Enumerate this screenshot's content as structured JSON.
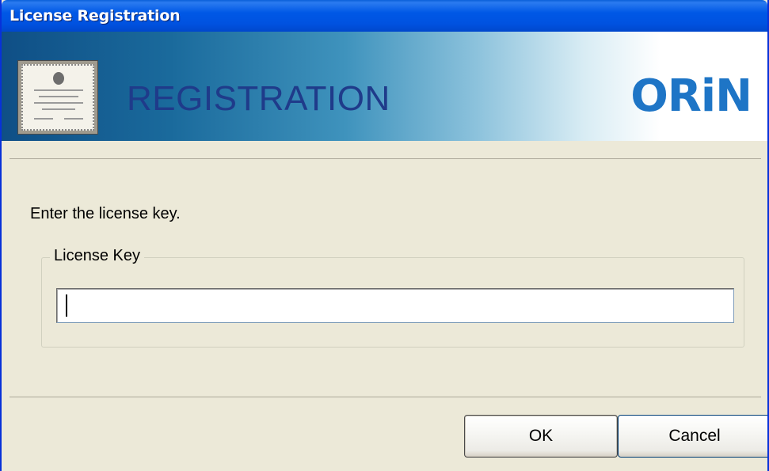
{
  "window": {
    "title": "License Registration"
  },
  "banner": {
    "heading": "REGISTRATION",
    "logo_text": "ORiN"
  },
  "content": {
    "prompt": "Enter the license key.",
    "group_label": "License Key",
    "license_key_value": ""
  },
  "buttons": {
    "ok_label": "OK",
    "cancel_label": "Cancel"
  },
  "colors": {
    "titlebar": "#0054e3",
    "dialog_background": "#ece9d8",
    "banner_heading": "#1f3b8a",
    "logo": "#1e75c6"
  }
}
